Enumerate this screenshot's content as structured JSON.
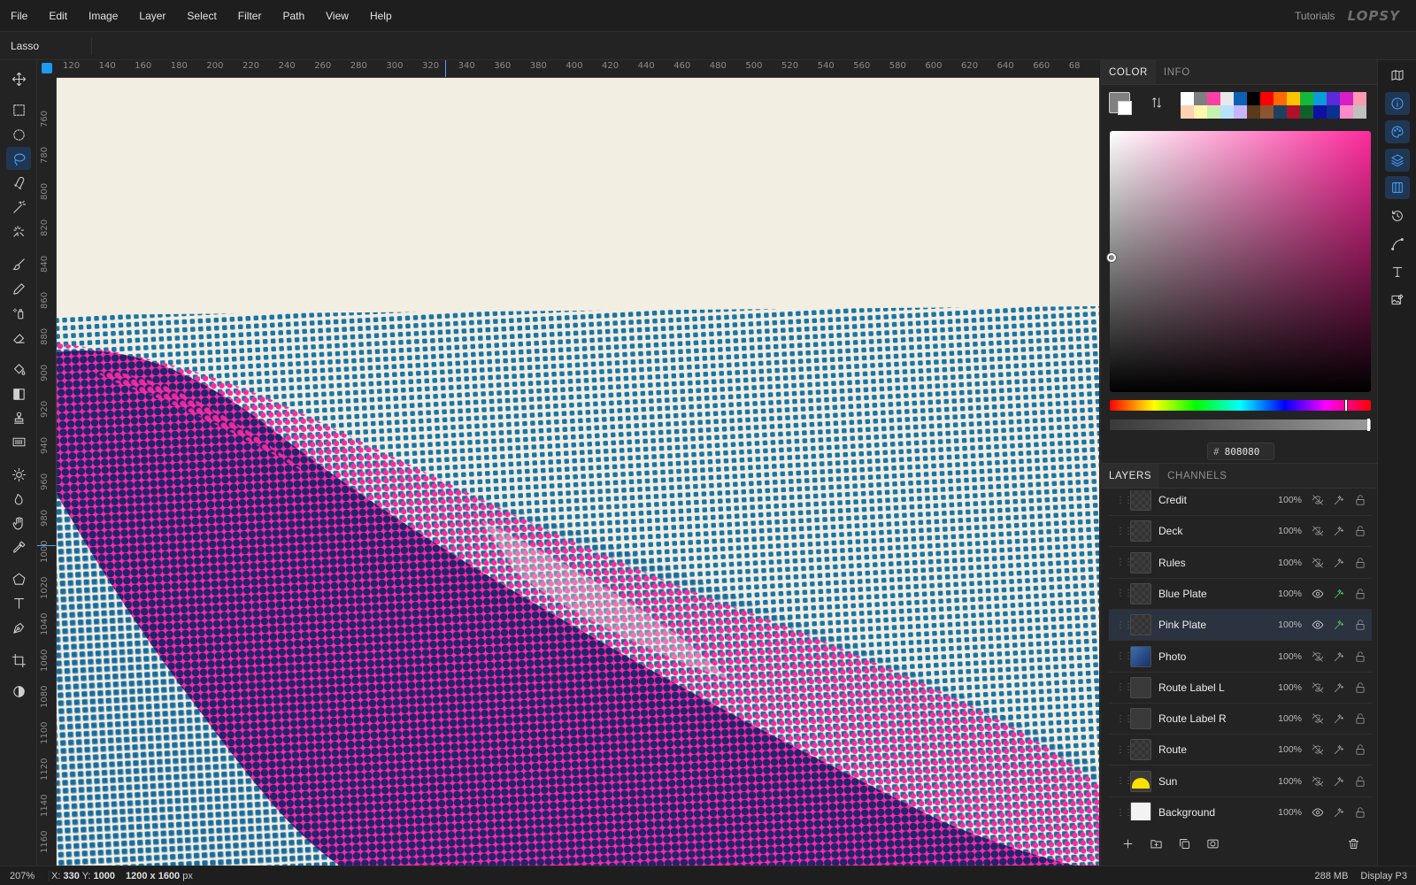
{
  "menu": [
    "File",
    "Edit",
    "Image",
    "Layer",
    "Select",
    "Filter",
    "Path",
    "View",
    "Help"
  ],
  "header": {
    "tutorials": "Tutorials",
    "logo": "LOPSY"
  },
  "options": {
    "tool_name": "Lasso"
  },
  "rulers": {
    "h_ticks": [
      "120",
      "140",
      "160",
      "180",
      "200",
      "220",
      "240",
      "260",
      "280",
      "300",
      "320",
      "340",
      "360",
      "380",
      "400",
      "420",
      "440",
      "460",
      "480",
      "500",
      "520",
      "540",
      "560",
      "580",
      "600",
      "620",
      "640",
      "660",
      "68"
    ],
    "v_ticks": [
      "760",
      "780",
      "800",
      "820",
      "840",
      "860",
      "880",
      "900",
      "920",
      "940",
      "960",
      "980",
      "1000",
      "1020",
      "1040",
      "1060",
      "1080",
      "1100",
      "1120",
      "1140",
      "1160"
    ]
  },
  "toolbar": {
    "tools": [
      {
        "name": "move-tool",
        "icon": "move-icon"
      },
      {
        "name": "rect-select-tool",
        "icon": "rect-select-icon"
      },
      {
        "name": "ellipse-select-tool",
        "icon": "ellipse-select-icon"
      },
      {
        "name": "lasso-tool",
        "icon": "lasso-icon",
        "active": true
      },
      {
        "name": "magnetic-lasso-tool",
        "icon": "magnetic-lasso-icon"
      },
      {
        "name": "magic-wand-tool",
        "icon": "magic-wand-icon"
      },
      {
        "name": "quick-select-tool",
        "icon": "quick-select-icon"
      },
      {
        "name": "brush-tool",
        "icon": "brush-icon"
      },
      {
        "name": "pencil-tool",
        "icon": "pencil-icon"
      },
      {
        "name": "spray-tool",
        "icon": "spray-icon"
      },
      {
        "name": "eraser-tool",
        "icon": "eraser-icon"
      },
      {
        "name": "fill-tool",
        "icon": "paint-bucket-icon"
      },
      {
        "name": "gradient-tool",
        "icon": "gradient-icon"
      },
      {
        "name": "stamp-tool",
        "icon": "clone-stamp-icon"
      },
      {
        "name": "pattern-tool",
        "icon": "pattern-icon"
      },
      {
        "name": "dodge-tool",
        "icon": "sun-icon"
      },
      {
        "name": "burn-tool",
        "icon": "flame-icon"
      },
      {
        "name": "hand-tool",
        "icon": "hand-icon"
      },
      {
        "name": "eyedropper-tool",
        "icon": "eyedropper-icon"
      },
      {
        "name": "shape-tool",
        "icon": "pentagon-icon"
      },
      {
        "name": "text-tool",
        "icon": "text-icon"
      },
      {
        "name": "pen-tool",
        "icon": "pen-icon"
      },
      {
        "name": "crop-tool",
        "icon": "crop-icon"
      },
      {
        "name": "mask-tool",
        "icon": "half-circle-icon"
      }
    ]
  },
  "color_panel": {
    "tabs": [
      "COLOR",
      "INFO"
    ],
    "active_tab": "COLOR",
    "foreground": "#808080",
    "background": "#ffffff",
    "hex_label": "#",
    "hex_value": "808080",
    "hue": "#ff2a9d",
    "palette": [
      "#ffffff",
      "#7f7f7f",
      "#ff3fa4",
      "#e8e8e8",
      "#0b62b4",
      "#000000",
      "#ff0000",
      "#ff6a00",
      "#ffc400",
      "#14b83a",
      "#0a9bd8",
      "#5b2bd9",
      "#d61fc4",
      "#ff9ab0",
      "#fbd3b0",
      "#fff6b0",
      "#c6f1b0",
      "#b8e2ff",
      "#c7b5ff",
      "#5a3a1a",
      "#8a5530",
      "#204060",
      "#b0102a",
      "#10602a",
      "#1010a0",
      "#0a3090",
      "#ff8ac8",
      "#c0c0c0"
    ]
  },
  "layers_panel": {
    "tabs": [
      "LAYERS",
      "CHANNELS"
    ],
    "active_tab": "LAYERS",
    "layers": [
      {
        "name": "Credit",
        "opacity": "100%",
        "visible": false,
        "fx": false,
        "thumb": "empty"
      },
      {
        "name": "Deck",
        "opacity": "100%",
        "visible": false,
        "fx": false,
        "thumb": "empty"
      },
      {
        "name": "Rules",
        "opacity": "100%",
        "visible": false,
        "fx": false,
        "thumb": "empty"
      },
      {
        "name": "Blue Plate",
        "opacity": "100%",
        "visible": true,
        "fx": true,
        "thumb": "empty"
      },
      {
        "name": "Pink Plate",
        "opacity": "100%",
        "visible": true,
        "fx": true,
        "thumb": "empty",
        "selected": true
      },
      {
        "name": "Photo",
        "opacity": "100%",
        "visible": false,
        "fx": false,
        "thumb": "photo"
      },
      {
        "name": "Route Label L",
        "opacity": "100%",
        "visible": false,
        "fx": false,
        "thumb": "label"
      },
      {
        "name": "Route Label R",
        "opacity": "100%",
        "visible": false,
        "fx": false,
        "thumb": "label"
      },
      {
        "name": "Route",
        "opacity": "100%",
        "visible": false,
        "fx": false,
        "thumb": "empty"
      },
      {
        "name": "Sun",
        "opacity": "100%",
        "visible": false,
        "fx": false,
        "thumb": "sun"
      },
      {
        "name": "Background",
        "opacity": "100%",
        "visible": true,
        "fx": false,
        "thumb": "white"
      }
    ]
  },
  "side_icons": [
    {
      "name": "map-icon",
      "active": false
    },
    {
      "name": "info-icon",
      "active": true
    },
    {
      "name": "palette-icon",
      "active": true
    },
    {
      "name": "layers-icon",
      "active": true
    },
    {
      "name": "columns-icon",
      "active": true
    },
    {
      "name": "history-icon",
      "active": false
    },
    {
      "name": "curve-icon",
      "active": false
    },
    {
      "name": "type-icon",
      "active": false
    },
    {
      "name": "image-edit-icon",
      "active": false
    }
  ],
  "status": {
    "zoom": "207%",
    "x_label": "X:",
    "x": "330",
    "y_label": "Y:",
    "y": "1000",
    "size": "1200 x 1600",
    "size_unit": "px",
    "memory": "288 MB",
    "profile": "Display P3"
  },
  "colors": {
    "accent": "#1d9bf0",
    "paper": "#f3eee2",
    "cyan_ink": "#1776a8",
    "magenta_ink": "#ff2aa0",
    "navy_ink": "#23236f"
  }
}
